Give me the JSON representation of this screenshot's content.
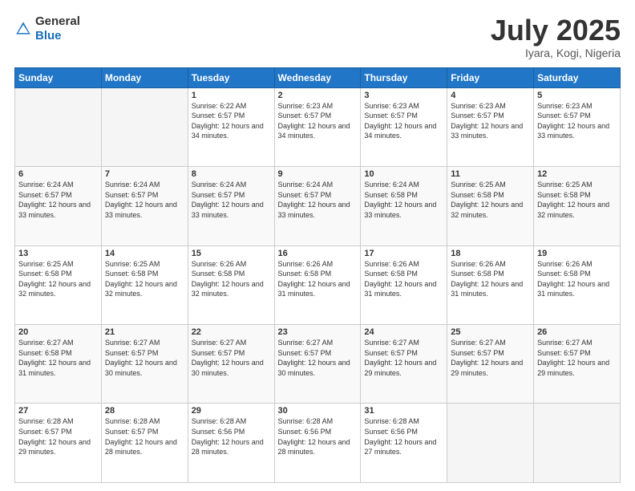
{
  "header": {
    "logo_general": "General",
    "logo_blue": "Blue",
    "title": "July 2025",
    "subtitle": "Iyara, Kogi, Nigeria"
  },
  "days_of_week": [
    "Sunday",
    "Monday",
    "Tuesday",
    "Wednesday",
    "Thursday",
    "Friday",
    "Saturday"
  ],
  "weeks": [
    [
      {
        "day": "",
        "sunrise": "",
        "sunset": "",
        "daylight": ""
      },
      {
        "day": "",
        "sunrise": "",
        "sunset": "",
        "daylight": ""
      },
      {
        "day": "1",
        "sunrise": "Sunrise: 6:22 AM",
        "sunset": "Sunset: 6:57 PM",
        "daylight": "Daylight: 12 hours and 34 minutes."
      },
      {
        "day": "2",
        "sunrise": "Sunrise: 6:23 AM",
        "sunset": "Sunset: 6:57 PM",
        "daylight": "Daylight: 12 hours and 34 minutes."
      },
      {
        "day": "3",
        "sunrise": "Sunrise: 6:23 AM",
        "sunset": "Sunset: 6:57 PM",
        "daylight": "Daylight: 12 hours and 34 minutes."
      },
      {
        "day": "4",
        "sunrise": "Sunrise: 6:23 AM",
        "sunset": "Sunset: 6:57 PM",
        "daylight": "Daylight: 12 hours and 33 minutes."
      },
      {
        "day": "5",
        "sunrise": "Sunrise: 6:23 AM",
        "sunset": "Sunset: 6:57 PM",
        "daylight": "Daylight: 12 hours and 33 minutes."
      }
    ],
    [
      {
        "day": "6",
        "sunrise": "Sunrise: 6:24 AM",
        "sunset": "Sunset: 6:57 PM",
        "daylight": "Daylight: 12 hours and 33 minutes."
      },
      {
        "day": "7",
        "sunrise": "Sunrise: 6:24 AM",
        "sunset": "Sunset: 6:57 PM",
        "daylight": "Daylight: 12 hours and 33 minutes."
      },
      {
        "day": "8",
        "sunrise": "Sunrise: 6:24 AM",
        "sunset": "Sunset: 6:57 PM",
        "daylight": "Daylight: 12 hours and 33 minutes."
      },
      {
        "day": "9",
        "sunrise": "Sunrise: 6:24 AM",
        "sunset": "Sunset: 6:57 PM",
        "daylight": "Daylight: 12 hours and 33 minutes."
      },
      {
        "day": "10",
        "sunrise": "Sunrise: 6:24 AM",
        "sunset": "Sunset: 6:58 PM",
        "daylight": "Daylight: 12 hours and 33 minutes."
      },
      {
        "day": "11",
        "sunrise": "Sunrise: 6:25 AM",
        "sunset": "Sunset: 6:58 PM",
        "daylight": "Daylight: 12 hours and 32 minutes."
      },
      {
        "day": "12",
        "sunrise": "Sunrise: 6:25 AM",
        "sunset": "Sunset: 6:58 PM",
        "daylight": "Daylight: 12 hours and 32 minutes."
      }
    ],
    [
      {
        "day": "13",
        "sunrise": "Sunrise: 6:25 AM",
        "sunset": "Sunset: 6:58 PM",
        "daylight": "Daylight: 12 hours and 32 minutes."
      },
      {
        "day": "14",
        "sunrise": "Sunrise: 6:25 AM",
        "sunset": "Sunset: 6:58 PM",
        "daylight": "Daylight: 12 hours and 32 minutes."
      },
      {
        "day": "15",
        "sunrise": "Sunrise: 6:26 AM",
        "sunset": "Sunset: 6:58 PM",
        "daylight": "Daylight: 12 hours and 32 minutes."
      },
      {
        "day": "16",
        "sunrise": "Sunrise: 6:26 AM",
        "sunset": "Sunset: 6:58 PM",
        "daylight": "Daylight: 12 hours and 31 minutes."
      },
      {
        "day": "17",
        "sunrise": "Sunrise: 6:26 AM",
        "sunset": "Sunset: 6:58 PM",
        "daylight": "Daylight: 12 hours and 31 minutes."
      },
      {
        "day": "18",
        "sunrise": "Sunrise: 6:26 AM",
        "sunset": "Sunset: 6:58 PM",
        "daylight": "Daylight: 12 hours and 31 minutes."
      },
      {
        "day": "19",
        "sunrise": "Sunrise: 6:26 AM",
        "sunset": "Sunset: 6:58 PM",
        "daylight": "Daylight: 12 hours and 31 minutes."
      }
    ],
    [
      {
        "day": "20",
        "sunrise": "Sunrise: 6:27 AM",
        "sunset": "Sunset: 6:58 PM",
        "daylight": "Daylight: 12 hours and 31 minutes."
      },
      {
        "day": "21",
        "sunrise": "Sunrise: 6:27 AM",
        "sunset": "Sunset: 6:57 PM",
        "daylight": "Daylight: 12 hours and 30 minutes."
      },
      {
        "day": "22",
        "sunrise": "Sunrise: 6:27 AM",
        "sunset": "Sunset: 6:57 PM",
        "daylight": "Daylight: 12 hours and 30 minutes."
      },
      {
        "day": "23",
        "sunrise": "Sunrise: 6:27 AM",
        "sunset": "Sunset: 6:57 PM",
        "daylight": "Daylight: 12 hours and 30 minutes."
      },
      {
        "day": "24",
        "sunrise": "Sunrise: 6:27 AM",
        "sunset": "Sunset: 6:57 PM",
        "daylight": "Daylight: 12 hours and 29 minutes."
      },
      {
        "day": "25",
        "sunrise": "Sunrise: 6:27 AM",
        "sunset": "Sunset: 6:57 PM",
        "daylight": "Daylight: 12 hours and 29 minutes."
      },
      {
        "day": "26",
        "sunrise": "Sunrise: 6:27 AM",
        "sunset": "Sunset: 6:57 PM",
        "daylight": "Daylight: 12 hours and 29 minutes."
      }
    ],
    [
      {
        "day": "27",
        "sunrise": "Sunrise: 6:28 AM",
        "sunset": "Sunset: 6:57 PM",
        "daylight": "Daylight: 12 hours and 29 minutes."
      },
      {
        "day": "28",
        "sunrise": "Sunrise: 6:28 AM",
        "sunset": "Sunset: 6:57 PM",
        "daylight": "Daylight: 12 hours and 28 minutes."
      },
      {
        "day": "29",
        "sunrise": "Sunrise: 6:28 AM",
        "sunset": "Sunset: 6:56 PM",
        "daylight": "Daylight: 12 hours and 28 minutes."
      },
      {
        "day": "30",
        "sunrise": "Sunrise: 6:28 AM",
        "sunset": "Sunset: 6:56 PM",
        "daylight": "Daylight: 12 hours and 28 minutes."
      },
      {
        "day": "31",
        "sunrise": "Sunrise: 6:28 AM",
        "sunset": "Sunset: 6:56 PM",
        "daylight": "Daylight: 12 hours and 27 minutes."
      },
      {
        "day": "",
        "sunrise": "",
        "sunset": "",
        "daylight": ""
      },
      {
        "day": "",
        "sunrise": "",
        "sunset": "",
        "daylight": ""
      }
    ]
  ]
}
